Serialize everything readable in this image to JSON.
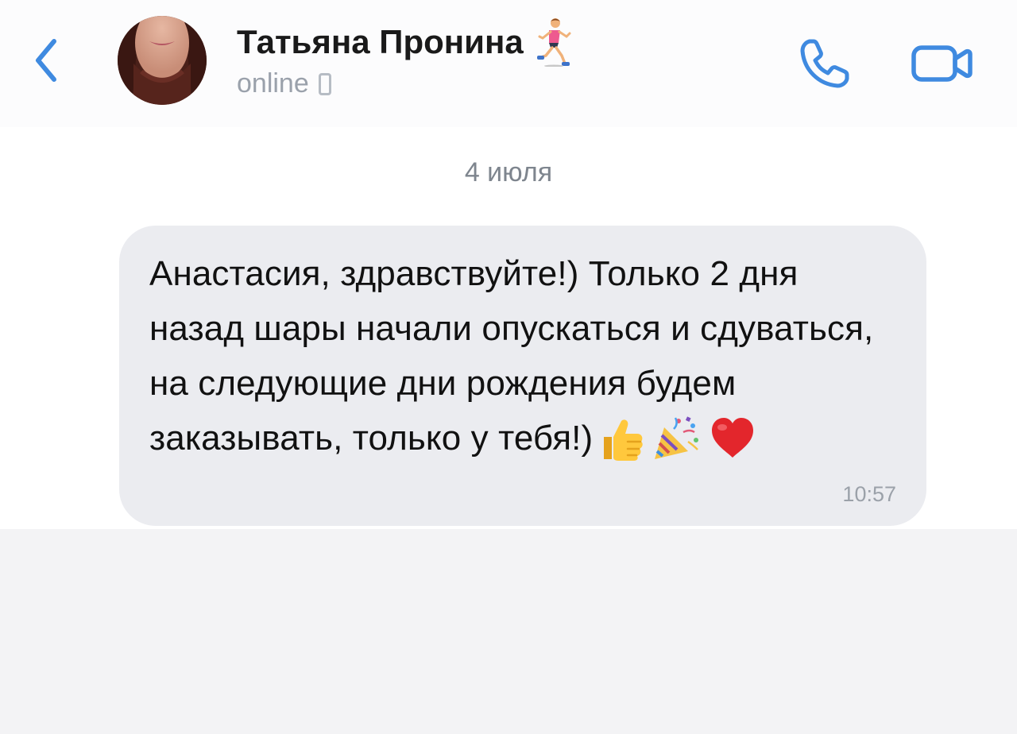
{
  "header": {
    "contact_name": "Татьяна Пронина",
    "status": "online",
    "name_emoji": "runner-woman-icon"
  },
  "chat": {
    "date_separator": "4 июля",
    "messages": [
      {
        "text": "Анастасия, здравствуйте!) Только 2 дня назад шары начали опускаться и сдуваться, на следующие дни рождения будем заказывать, только у тебя!)",
        "emojis": [
          "thumbs-up-icon",
          "party-popper-icon",
          "red-heart-icon"
        ],
        "time": "10:57"
      }
    ]
  },
  "colors": {
    "accent": "#3f8ae0",
    "bubble_bg": "#ebecf0",
    "status_gray": "#9aa1ab",
    "heart_red": "#e3262c"
  }
}
